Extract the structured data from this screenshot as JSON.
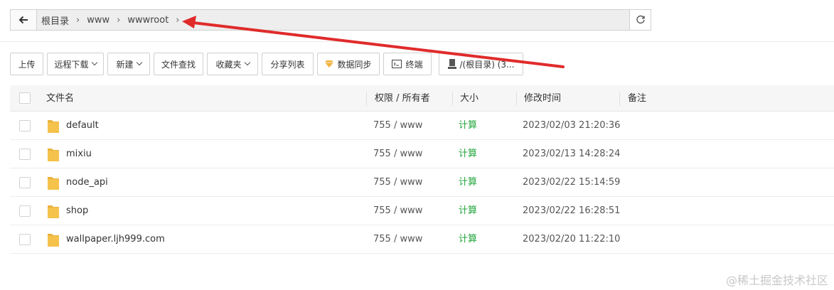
{
  "path": {
    "crumbs": [
      "根目录",
      "www",
      "wwwroot"
    ],
    "back_icon": "arrow-left-icon",
    "refresh_icon": "refresh-icon"
  },
  "toolbar": {
    "upload": "上传",
    "remote_download": "远程下载",
    "new": "新建",
    "file_search": "文件查找",
    "favorites": "收藏夹",
    "share_list": "分享列表",
    "sync": "数据同步",
    "terminal": "终端",
    "disk": "/(根目录) (3..."
  },
  "table": {
    "columns": [
      "文件名",
      "权限 / 所有者",
      "大小",
      "修改时间",
      "备注"
    ],
    "rows": [
      {
        "name": "default",
        "perm": "755 / www",
        "size": "计算",
        "mtime": "2023/02/03 21:20:36",
        "note": ""
      },
      {
        "name": "mixiu",
        "perm": "755 / www",
        "size": "计算",
        "mtime": "2023/02/13 14:28:24",
        "note": ""
      },
      {
        "name": "node_api",
        "perm": "755 / www",
        "size": "计算",
        "mtime": "2023/02/22 15:14:59",
        "note": ""
      },
      {
        "name": "shop",
        "perm": "755 / www",
        "size": "计算",
        "mtime": "2023/02/22 16:28:51",
        "note": ""
      },
      {
        "name": "wallpaper.ljh999.com",
        "perm": "755 / www",
        "size": "计算",
        "mtime": "2023/02/20 11:22:10",
        "note": ""
      }
    ]
  },
  "colors": {
    "calc_green": "#20a53a",
    "folder_yellow": "#f5c24c",
    "annotation_red": "#e02b2b"
  },
  "watermark": "@稀土掘金技术社区"
}
